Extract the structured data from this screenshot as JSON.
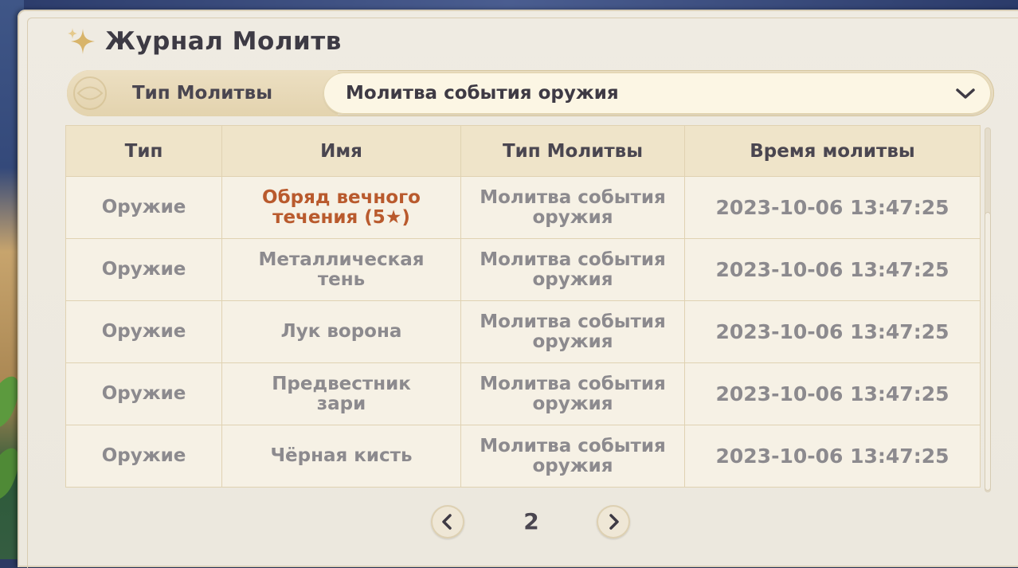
{
  "header": {
    "title": "Журнал Молитв",
    "icon": "sparkle-icon"
  },
  "filter": {
    "label": "Тип Молитвы",
    "selected": "Молитва события оружия",
    "icon": "chevron-down-icon"
  },
  "table": {
    "columns": [
      "Тип",
      "Имя",
      "Тип Молитвы",
      "Время молитвы"
    ],
    "rows": [
      {
        "type": "Оружие",
        "name": "Обряд вечного течения (5★)",
        "banner": "Молитва события оружия",
        "time": "2023-10-06 13:47:25",
        "rarity_color": "#b95a2d"
      },
      {
        "type": "Оружие",
        "name": "Металлическая тень",
        "banner": "Молитва события оружия",
        "time": "2023-10-06 13:47:25"
      },
      {
        "type": "Оружие",
        "name": "Лук ворона",
        "banner": "Молитва события оружия",
        "time": "2023-10-06 13:47:25"
      },
      {
        "type": "Оружие",
        "name": "Предвестник зари",
        "banner": "Молитва события оружия",
        "time": "2023-10-06 13:47:25"
      },
      {
        "type": "Оружие",
        "name": "Чёрная кисть",
        "banner": "Молитва события оружия",
        "time": "2023-10-06 13:47:25"
      }
    ]
  },
  "pagination": {
    "current_page": "2",
    "prev_icon": "chevron-left-icon",
    "next_icon": "chevron-right-icon"
  },
  "colors": {
    "accent_five_star": "#b95a2d",
    "text_dark": "#3d3a44",
    "text_muted": "#8c8a8e"
  }
}
